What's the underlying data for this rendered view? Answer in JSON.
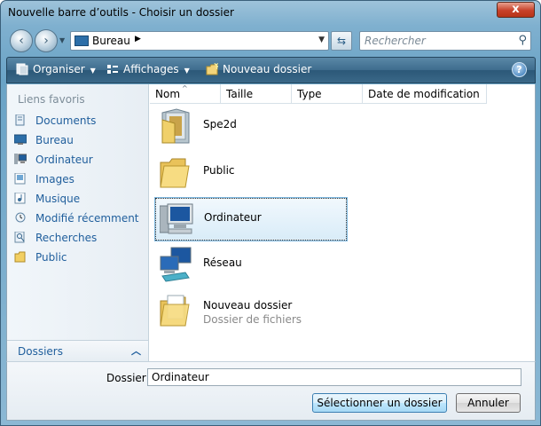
{
  "window": {
    "title": "Nouvelle barre d’outils - Choisir un dossier",
    "close": "x"
  },
  "nav": {
    "back": "‹",
    "forward": "›",
    "address": "Bureau",
    "search_placeholder": "Rechercher"
  },
  "toolbar": {
    "organize": "Organiser",
    "views": "Affichages",
    "new_folder": "Nouveau dossier",
    "help": "?"
  },
  "sidebar": {
    "header": "Liens favoris",
    "items": [
      {
        "label": "Documents",
        "icon": "documents-icon"
      },
      {
        "label": "Bureau",
        "icon": "desktop-icon"
      },
      {
        "label": "Ordinateur",
        "icon": "computer-icon"
      },
      {
        "label": "Images",
        "icon": "pictures-icon"
      },
      {
        "label": "Musique",
        "icon": "music-icon"
      },
      {
        "label": "Modifié récemment",
        "icon": "recent-icon"
      },
      {
        "label": "Recherches",
        "icon": "searches-icon"
      },
      {
        "label": "Public",
        "icon": "folder-icon"
      }
    ],
    "folders_label": "Dossiers"
  },
  "columns": [
    "Nom",
    "Taille",
    "Type",
    "Date de modification"
  ],
  "files": [
    {
      "name": "Spe2d",
      "sub": "",
      "icon": "user-folder-icon"
    },
    {
      "name": "Public",
      "sub": "",
      "icon": "folder-icon"
    },
    {
      "name": "Ordinateur",
      "sub": "",
      "icon": "computer-icon",
      "selected": true
    },
    {
      "name": "Réseau",
      "sub": "",
      "icon": "network-icon"
    },
    {
      "name": "Nouveau dossier",
      "sub": "Dossier de fichiers",
      "icon": "folder-icon"
    }
  ],
  "footer": {
    "folder_label": "Dossier :",
    "folder_value": "Ordinateur",
    "select_button": "Sélectionner un dossier",
    "cancel_button": "Annuler"
  }
}
